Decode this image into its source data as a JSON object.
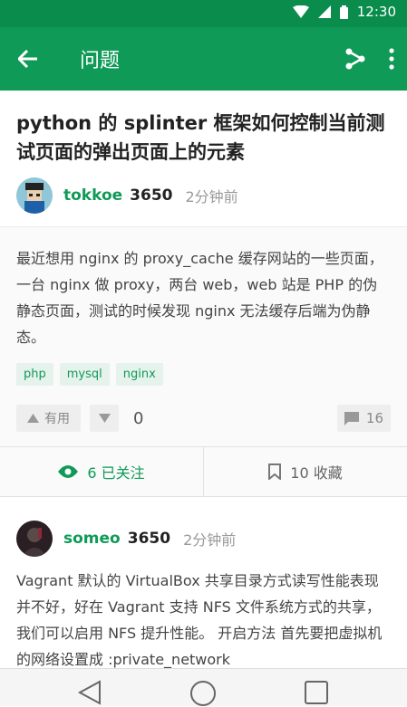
{
  "status": {
    "time": "12:30"
  },
  "appbar": {
    "title": "问题"
  },
  "question": {
    "title": "python 的 splinter 框架如何控制当前测试页面的弹出页面上的元素",
    "author": "tokkoe",
    "rep": "3650",
    "time": "2分钟前",
    "body": "最近想用 nginx 的 proxy_cache 缓存网站的一些页面，一台 nginx 做 proxy，两台 web，web 站是 PHP 的伪静态页面，测试的时候发现 nginx 无法缓存后端为伪静态。",
    "tags": [
      "php",
      "mysql",
      "nginx"
    ],
    "upvote_label": "有用",
    "votes": "0",
    "comments": "16"
  },
  "actions": {
    "follow": "6 已关注",
    "bookmark": "10 收藏"
  },
  "answer": {
    "author": "someo",
    "rep": "3650",
    "time": "2分钟前",
    "body": "Vagrant 默认的 VirtualBox 共享目录方式读写性能表现并不好，好在 Vagrant 支持 NFS 文件系统方式的共享，我们可以启用 NFS 提升性能。 开启方法 首先要把虚拟机的网络设置成 :private_network"
  },
  "colors": {
    "accent": "#0f9a57",
    "statusbar": "#0a8c4c"
  }
}
